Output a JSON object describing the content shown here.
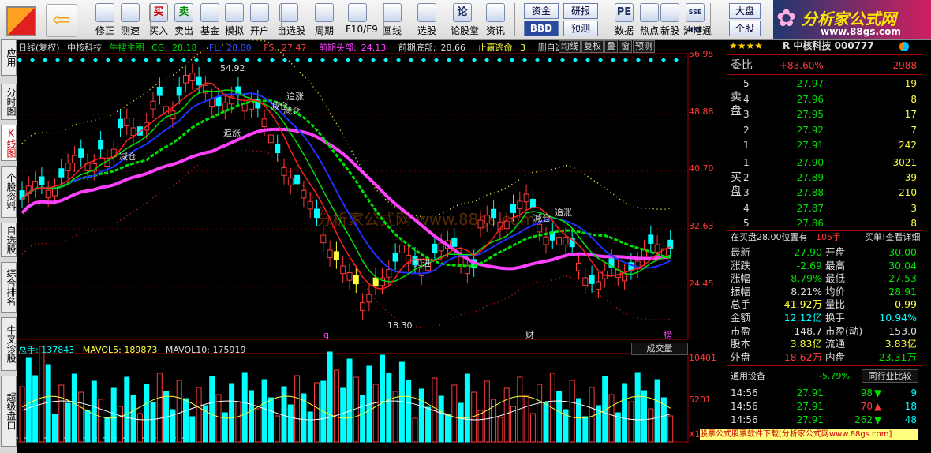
{
  "toolbar": {
    "buttons": [
      {
        "label": "修正",
        "icon": "arrow-up-down-icon"
      },
      {
        "label": "测速",
        "icon": "clock-icon"
      },
      {
        "label": "买入",
        "glyph": "买"
      },
      {
        "label": "卖出",
        "glyph": "卖"
      },
      {
        "label": "基金",
        "icon": "fund-icon"
      },
      {
        "label": "模拟",
        "icon": "hammer-icon"
      },
      {
        "label": "开户",
        "icon": "lock-icon"
      },
      {
        "label": "自选股",
        "icon": "favorites-icon"
      },
      {
        "label": "周期",
        "icon": "cycle-icon"
      },
      {
        "label": "F10/F9",
        "icon": "f10-icon"
      },
      {
        "label": "画线",
        "icon": "pen-icon"
      },
      {
        "label": "选股",
        "icon": "screen-icon"
      },
      {
        "label": "论股堂",
        "glyph": "论"
      },
      {
        "label": "资讯",
        "icon": "news-icon"
      },
      {
        "label": "数据",
        "glyph": "PE"
      },
      {
        "label": "热点",
        "icon": "hot-icon"
      },
      {
        "label": "新股",
        "icon": "new-stock-icon"
      },
      {
        "label": "沪港通",
        "glyph": "SSE HKE"
      }
    ],
    "mini_buttons": {
      "zijin": "资金",
      "bbd": "BBD",
      "yanbao": "研报",
      "yuce": "预测",
      "dapan": "大盘",
      "gegu": "个股"
    },
    "brand": {
      "title": "分析家公式网",
      "url": "www.88gs.com"
    }
  },
  "left_tabs": [
    "应用",
    "分时图",
    "K线图",
    "个股资料",
    "自选股",
    "综合排名",
    "牛叉诊股",
    "超级盘口"
  ],
  "chart": {
    "info": {
      "period": "日线(复权)",
      "name": "中核科技",
      "indicator": "牛搜主图",
      "cg_label": "CG:",
      "cg": "28.18",
      "fl_label": "FL:",
      "fl": "28.80",
      "fs_label": "FS:",
      "fs": "27.47",
      "qqtb_label": "前期头部:",
      "qqtb": "24.13",
      "qqdb_label": "前期底部:",
      "qqdb": "28.66",
      "zytm": "止赢逃命:",
      "zytm_val": "3",
      "trail": "删自选"
    },
    "buttons": [
      "均线",
      "复权",
      "叠",
      "窗",
      "预测"
    ],
    "y_labels": [
      "56.95",
      "48.88",
      "40.70",
      "32.63",
      "24.45"
    ],
    "vol_y_labels": [
      "10401",
      "5201"
    ],
    "vol_unit": "X1",
    "high_label": "54.92",
    "low_label": "18.30",
    "annotations": {
      "jiancang1": "减仓",
      "zhuizhang1": "追涨",
      "jiancang2": "减仓",
      "zhuizhang2": "追涨",
      "jiancang3": "减仓",
      "maijin": "买进",
      "jiancang4": "减仓",
      "zhuizhang3": "追涨"
    },
    "markers": {
      "q": "q",
      "cai": "财",
      "bang": "榜"
    },
    "watermark": "分析家公式网    www.88gs.com",
    "volume": {
      "total_label": "总手:",
      "total": "137843",
      "ma5_label": "MAVOL5:",
      "ma5": "189873",
      "ma10_label": "MAVOL10:",
      "ma10": "175919",
      "selector": "成交量"
    },
    "bottom_note": "股票公式股票软件下载[分析家公式网www.88gs.com]"
  },
  "right_panel": {
    "stars": "★★★★",
    "stock_title": "R 中核科技 000777",
    "weibi_label": "委比",
    "weibi": "+83.60%",
    "weicha": "2988",
    "sell_label": "卖盘",
    "buy_label": "买盘",
    "sell": [
      {
        "lvl": "5",
        "price": "27.97",
        "vol": "19"
      },
      {
        "lvl": "4",
        "price": "27.96",
        "vol": "8"
      },
      {
        "lvl": "3",
        "price": "27.95",
        "vol": "17"
      },
      {
        "lvl": "2",
        "price": "27.92",
        "vol": "7"
      },
      {
        "lvl": "1",
        "price": "27.91",
        "vol": "242"
      }
    ],
    "buy": [
      {
        "lvl": "1",
        "price": "27.90",
        "vol": "3021"
      },
      {
        "lvl": "2",
        "price": "27.89",
        "vol": "39"
      },
      {
        "lvl": "3",
        "price": "27.88",
        "vol": "210"
      },
      {
        "lvl": "4",
        "price": "27.87",
        "vol": "3"
      },
      {
        "lvl": "5",
        "price": "27.86",
        "vol": "8"
      }
    ],
    "notice": "在买盘28.00位置有",
    "notice_vol": "105手",
    "notice_link": "买单!查看详细",
    "stats": [
      {
        "k1": "最新",
        "v1": "27.90",
        "c1": "g",
        "k2": "开盘",
        "v2": "30.00",
        "c2": "g"
      },
      {
        "k1": "涨跌",
        "v1": "-2.69",
        "c1": "g",
        "k2": "最高",
        "v2": "30.04",
        "c2": "g"
      },
      {
        "k1": "涨幅",
        "v1": "-8.79%",
        "c1": "g",
        "k2": "最低",
        "v2": "27.53",
        "c2": "g"
      },
      {
        "k1": "振幅",
        "v1": "8.21%",
        "c1": "w",
        "k2": "均价",
        "v2": "28.91",
        "c2": "g"
      },
      {
        "k1": "总手",
        "v1": "41.92万",
        "c1": "y",
        "k2": "量比",
        "v2": "0.99",
        "c2": "y"
      },
      {
        "k1": "金额",
        "v1": "12.12亿",
        "c1": "c",
        "k2": "换手",
        "v2": "10.94%",
        "c2": "c"
      },
      {
        "k1": "市盈",
        "v1": "148.7",
        "c1": "w",
        "k2": "市盈(动)",
        "v2": "153.0",
        "c2": "w"
      },
      {
        "k1": "股本",
        "v1": "3.83亿",
        "c1": "y",
        "k2": "流通",
        "v2": "3.83亿",
        "c2": "y"
      },
      {
        "k1": "外盘",
        "v1": "18.62万",
        "c1": "r",
        "k2": "内盘",
        "v2": "23.31万",
        "c2": "g"
      }
    ],
    "industry": {
      "name": "通用设备",
      "change": "-5.79%",
      "btn": "同行业比较"
    },
    "ticks": [
      {
        "time": "14:56",
        "price": "27.91",
        "vol": "98",
        "dir": "down",
        "cnt": "9"
      },
      {
        "time": "14:56",
        "price": "27.91",
        "vol": "70",
        "dir": "up",
        "cnt": "18"
      },
      {
        "time": "14:56",
        "price": "27.91",
        "vol": "262",
        "dir": "down",
        "cnt": "48"
      }
    ]
  },
  "colors": {
    "up": "#ff3b3b",
    "down": "#00ffff",
    "ma_green": "#00e000",
    "ma_blue": "#2030ff",
    "ma_red": "#ff2020",
    "magenta": "#ff40ff",
    "yellow": "#ffff3c"
  }
}
